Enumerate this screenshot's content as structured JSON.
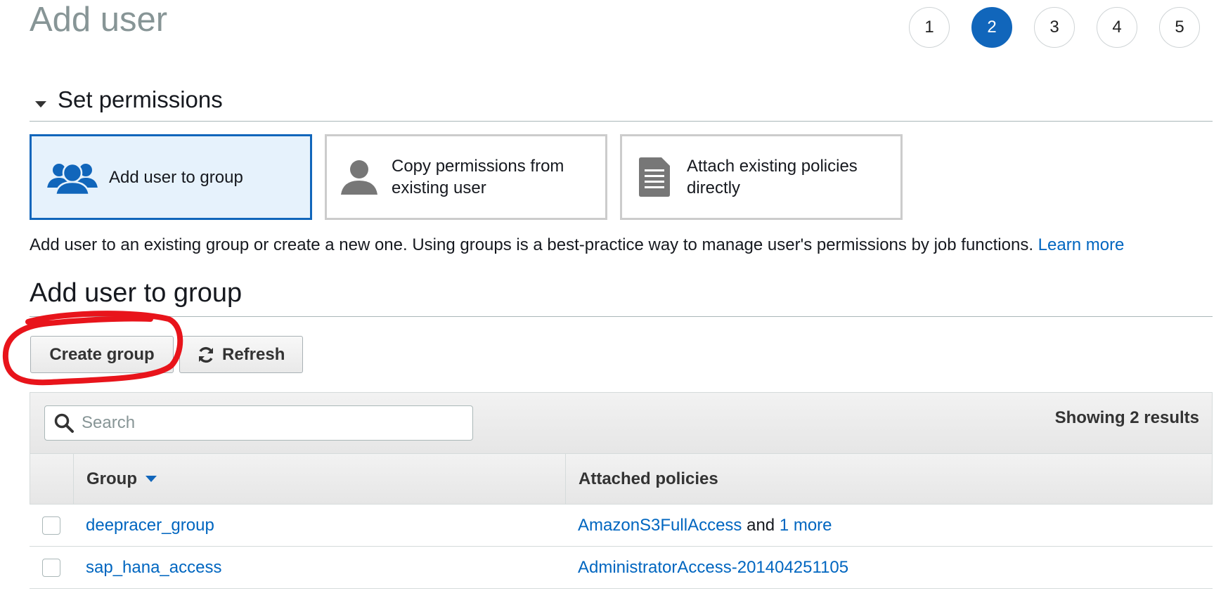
{
  "page_title": "Add user",
  "steps": [
    {
      "label": "1",
      "active": false
    },
    {
      "label": "2",
      "active": true
    },
    {
      "label": "3",
      "active": false
    },
    {
      "label": "4",
      "active": false
    },
    {
      "label": "5",
      "active": false
    }
  ],
  "permissions": {
    "title": "Set permissions",
    "options": {
      "add_to_group": "Add user to group",
      "copy_permissions_line1": "Copy permissions from",
      "copy_permissions_line2": "existing user",
      "attach_policies_line1": "Attach existing policies",
      "attach_policies_line2": "directly"
    },
    "description": "Add user to an existing group or create a new one. Using groups is a best-practice way to manage user's permissions by job functions.",
    "learn_more": "Learn more"
  },
  "group_section": {
    "title": "Add user to group",
    "create_button": "Create group",
    "refresh_button": "Refresh",
    "search_placeholder": "Search",
    "results_text": "Showing 2 results",
    "columns": {
      "group": "Group",
      "policies": "Attached policies"
    },
    "rows": [
      {
        "group": "deepracer_group",
        "policy": "AmazonS3FullAccess",
        "policy_joiner": "and",
        "policy_more": "1 more"
      },
      {
        "group": "sap_hana_access",
        "policy": "AdministratorAccess-201404251105",
        "policy_joiner": "",
        "policy_more": ""
      }
    ]
  },
  "colors": {
    "accent": "#1166bb",
    "link": "#0066c0",
    "annotation": "#e8141b"
  }
}
